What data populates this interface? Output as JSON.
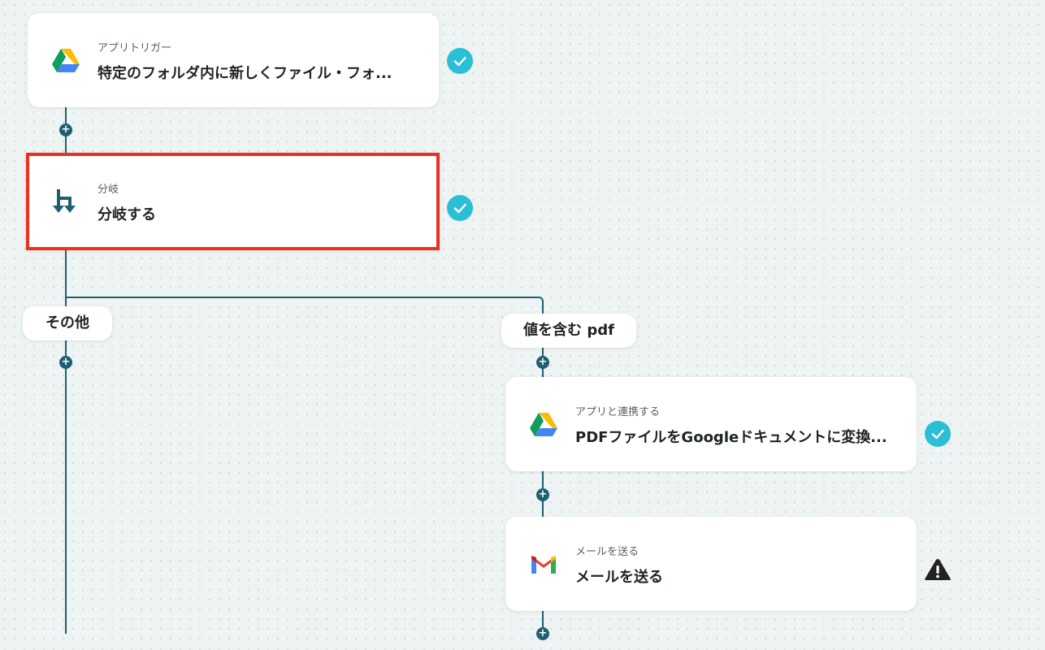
{
  "flow": {
    "trigger": {
      "sub": "アプリトリガー",
      "title": "特定のフォルダ内に新しくファイル・フォ...",
      "icon": "google-drive-icon",
      "status": "complete"
    },
    "branch": {
      "sub": "分岐",
      "title": "分岐する",
      "icon": "branch-icon",
      "status": "complete",
      "highlight_color": "#e8321f"
    },
    "branches": {
      "other": {
        "label": "その他"
      },
      "contains": {
        "label": "値を含む pdf"
      }
    },
    "convert": {
      "sub": "アプリと連携する",
      "title": "PDFファイルをGoogleドキュメントに変換...",
      "icon": "google-drive-icon",
      "status": "complete"
    },
    "mail": {
      "sub": "メールを送る",
      "title": "メールを送る",
      "icon": "gmail-icon",
      "status": "warning"
    }
  },
  "colors": {
    "connector": "#1e5f73",
    "check": "#2bbfd6",
    "warning": "#222222",
    "background": "#eef3f3"
  }
}
